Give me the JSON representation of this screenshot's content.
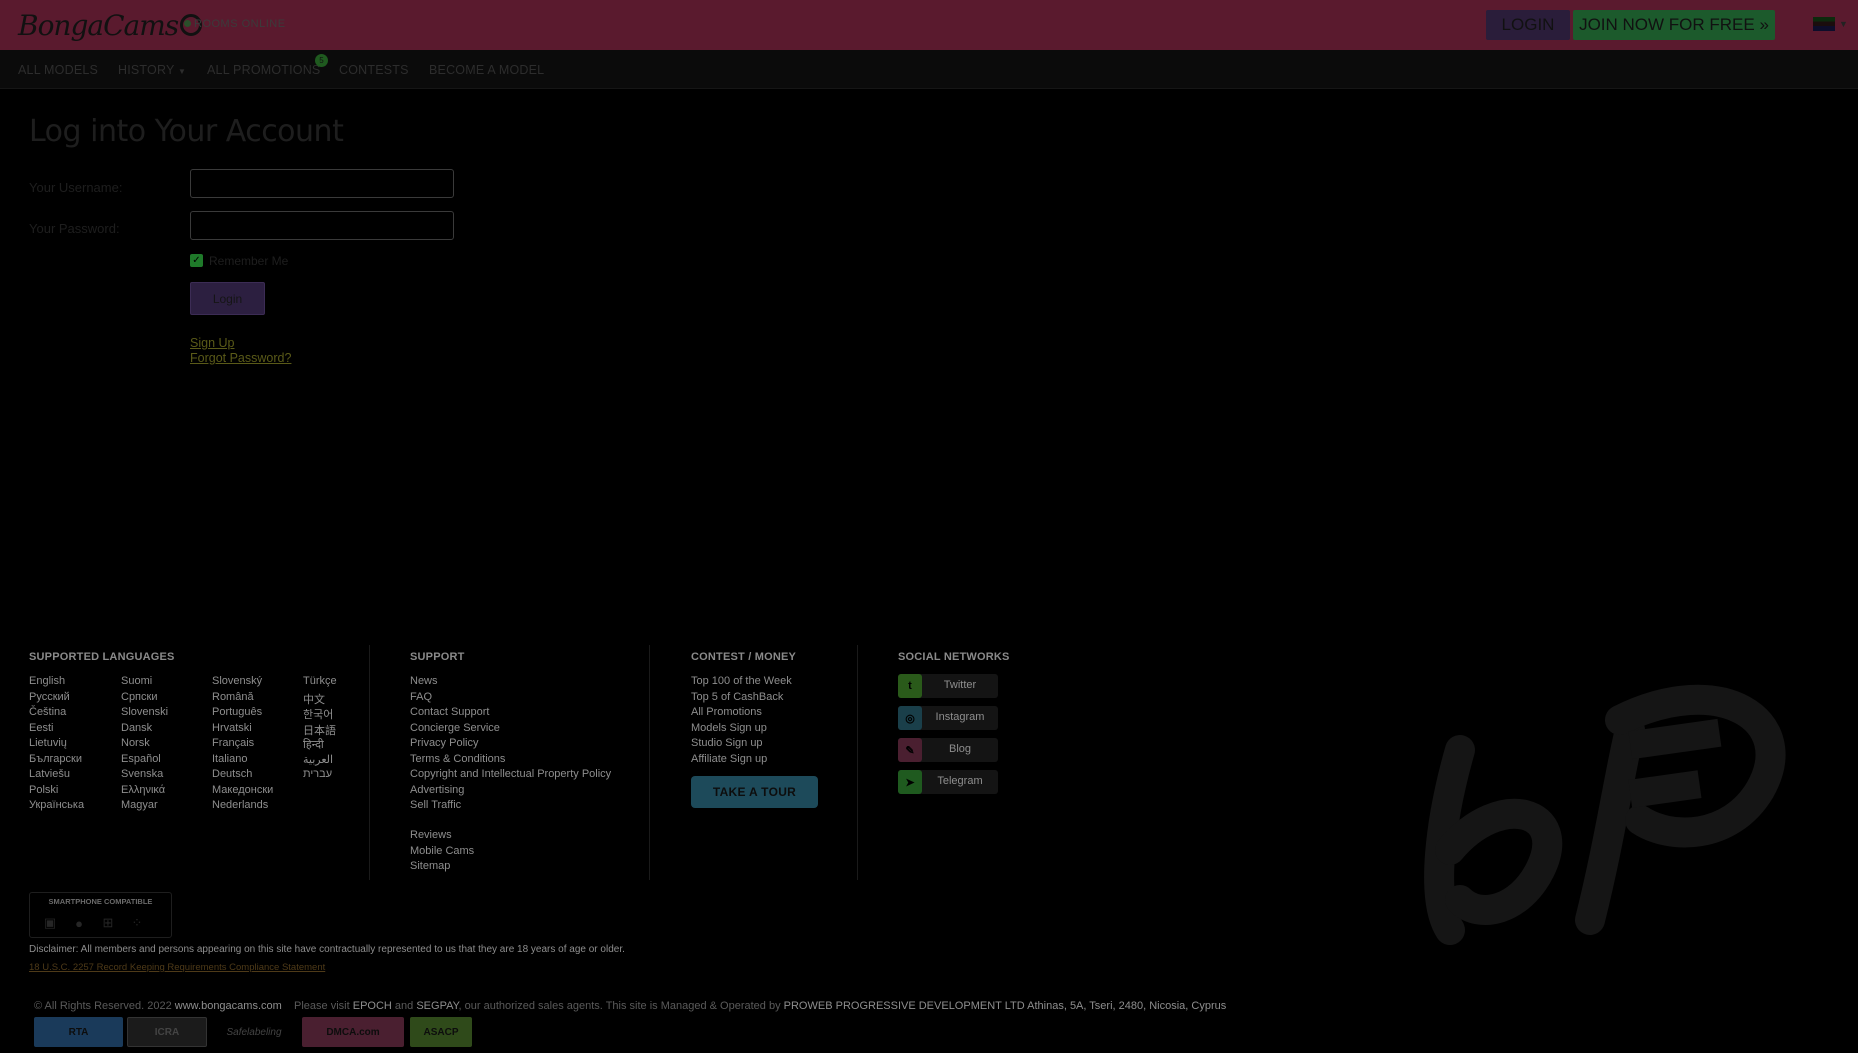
{
  "header": {
    "logo_text": "BongaCams",
    "online_text": "ROOMS ONLINE",
    "login_label": "LOGIN",
    "join_label": "JOIN NOW FOR FREE »"
  },
  "nav": {
    "items": [
      "ALL MODELS",
      "HISTORY",
      "ALL PROMOTIONS",
      "CONTESTS",
      "BECOME A MODEL"
    ],
    "promotions_badge": "5"
  },
  "login": {
    "title": "Log into Your Account",
    "username_label": "Your Username:",
    "password_label": "Your Password:",
    "remember_label": "Remember Me",
    "remember_checked": true,
    "submit_label": "Login",
    "signup_link": "Sign Up",
    "forgot_link": "Forgot Password?"
  },
  "footer": {
    "languages_heading": "SUPPORTED LANGUAGES",
    "languages": [
      [
        "English",
        "Русский",
        "Čeština",
        "Eesti",
        "Lietuvių",
        "Български",
        "Latviešu",
        "Polski",
        "Українська"
      ],
      [
        "Suomi",
        "Српски",
        "Slovenski",
        "Dansk",
        "Norsk",
        "Español",
        "Svenska",
        "Ελληνικά",
        "Magyar"
      ],
      [
        "Slovenský",
        "Română",
        "Português",
        "Hrvatski",
        "Français",
        "Italiano",
        "Deutsch",
        "Македонски",
        "Nederlands"
      ],
      [
        "Türkçe",
        "中文",
        "한국어",
        "日本語",
        "हिन्दी",
        "العربية",
        "עברית"
      ]
    ],
    "support_heading": "SUPPORT",
    "support_links": [
      "News",
      "FAQ",
      "Contact Support",
      "Concierge Service",
      "Privacy Policy",
      "Terms & Conditions",
      "Copyright and Intellectual Property Policy",
      "Advertising",
      "Sell Traffic"
    ],
    "support_links_2": [
      "Reviews",
      "Mobile Cams",
      "Sitemap"
    ],
    "contest_heading": "CONTEST / MONEY",
    "contest_links": [
      "Top 100 of the Week",
      "Top 5 of CashBack",
      "All Promotions",
      "Models Sign up",
      "Studio Sign up",
      "Affiliate Sign up"
    ],
    "tour_label": "TAKE A TOUR",
    "social_heading": "SOCIAL NETWORKS",
    "social": [
      {
        "label": "Twitter",
        "icon": "twitter-icon",
        "color": "#2a5a1a"
      },
      {
        "label": "Instagram",
        "icon": "instagram-icon",
        "color": "#1a3f4a"
      },
      {
        "label": "Blog",
        "icon": "blog-icon",
        "color": "#4a1f30"
      },
      {
        "label": "Telegram",
        "icon": "telegram-icon",
        "color": "#1f5a1f"
      }
    ],
    "smartphone_title": "SMARTPHONE COMPATIBLE",
    "disclaimer": "Disclaimer: All members and persons appearing on this site have contractually represented to us that they are 18 years of age or older.",
    "compliance_link": "18 U.S.C. 2257 Record Keeping Requirements Compliance Statement",
    "copyright_prefix": "© All Rights Reserved. 2022",
    "copyright_domain": "www.bongacams.com",
    "visit_text": "Please visit",
    "epoch": "EPOCH",
    "and_text": "and",
    "segpay": "SEGPAY",
    "agents_text": ", our authorized sales agents. This site is Managed & Operated by",
    "operator": "PROWEB PROGRESSIVE DEVELOPMENT LTD Athinas, 5A, Tseri, 2480, Nicosia, Cyprus",
    "certs": [
      "RTA",
      "ICRA",
      "Safelabeling",
      "DMCA.com",
      "ASACP"
    ]
  }
}
